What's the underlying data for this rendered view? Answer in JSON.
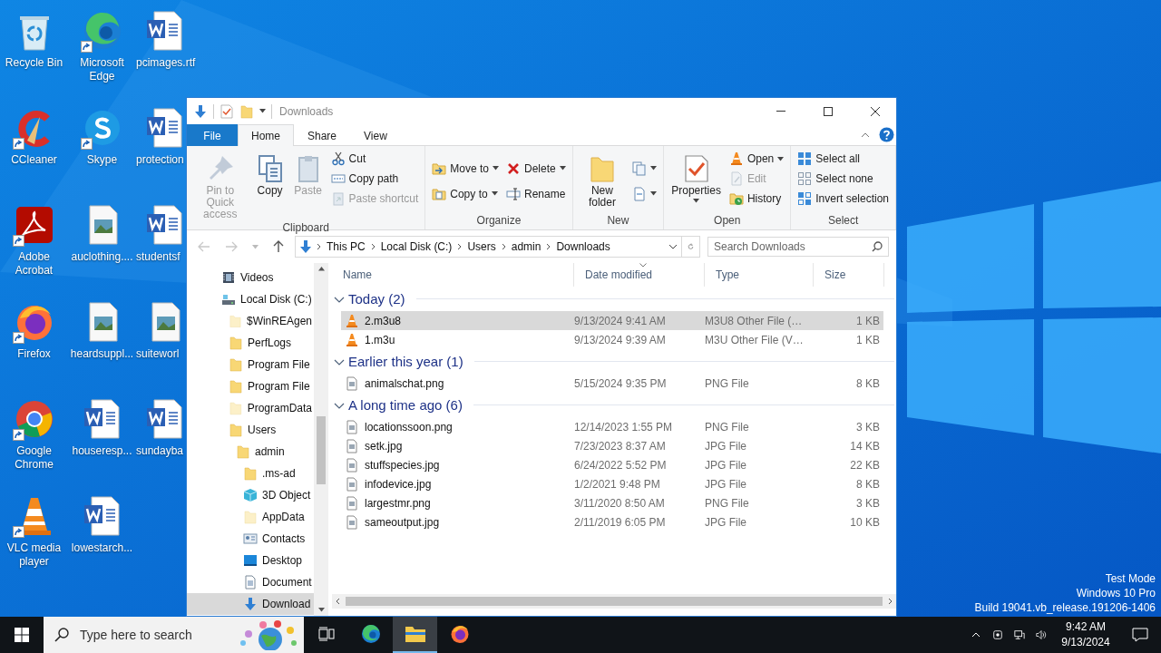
{
  "desktop": {
    "icons": [
      {
        "label": "Recycle Bin",
        "kind": "recycle",
        "shortcut": false
      },
      {
        "label": "CCleaner",
        "kind": "ccleaner",
        "shortcut": true
      },
      {
        "label": "Adobe Acrobat",
        "kind": "acrobat",
        "shortcut": true
      },
      {
        "label": "Firefox",
        "kind": "firefox",
        "shortcut": true
      },
      {
        "label": "Google Chrome",
        "kind": "chrome",
        "shortcut": true
      },
      {
        "label": "VLC media player",
        "kind": "vlc",
        "shortcut": true
      },
      {
        "label": "Microsoft Edge",
        "kind": "edge",
        "shortcut": true
      },
      {
        "label": "Skype",
        "kind": "skype",
        "shortcut": true
      },
      {
        "label": "auclothing....",
        "kind": "image",
        "shortcut": false
      },
      {
        "label": "heardsuppl...",
        "kind": "image",
        "shortcut": false
      },
      {
        "label": "houseresp...",
        "kind": "word",
        "shortcut": false
      },
      {
        "label": "lowestarch...",
        "kind": "word",
        "shortcut": false
      },
      {
        "label": "pcimages.rtf",
        "kind": "word",
        "shortcut": false
      },
      {
        "label": "protection",
        "kind": "word",
        "shortcut": false
      },
      {
        "label": "studentsf",
        "kind": "word",
        "shortcut": false
      },
      {
        "label": "suiteworl",
        "kind": "image",
        "shortcut": false
      },
      {
        "label": "sundayba",
        "kind": "word",
        "shortcut": false
      }
    ],
    "system_info": [
      "Test Mode",
      "Windows 10 Pro",
      "Build 19041.vb_release.191206-1406"
    ]
  },
  "window": {
    "title": "Downloads",
    "tabs": [
      {
        "label": "File",
        "kind": "menu",
        "selected": false
      },
      {
        "label": "Home",
        "kind": "tab",
        "selected": true
      },
      {
        "label": "Share",
        "kind": "tab",
        "selected": false
      },
      {
        "label": "View",
        "kind": "tab",
        "selected": false
      }
    ],
    "ribbon": [
      {
        "label": "Clipboard",
        "columns": [
          [
            {
              "label": "Pin to Quick access",
              "kind": "pin",
              "disabled": true,
              "menu": false
            }
          ],
          [
            {
              "label": "Copy",
              "kind": "copy",
              "disabled": false,
              "menu": false
            }
          ],
          [
            {
              "label": "Paste",
              "kind": "paste",
              "disabled": true,
              "menu": false
            }
          ],
          [
            {
              "label": "Cut",
              "kind": "cut",
              "disabled": false,
              "menu": false
            },
            {
              "label": "Copy path",
              "kind": "copypath",
              "disabled": false,
              "menu": false
            },
            {
              "label": "Paste shortcut",
              "kind": "pasteshortcut",
              "disabled": true,
              "menu": false
            }
          ]
        ]
      },
      {
        "label": "Organize",
        "columns": [
          [
            {
              "label": "Move to",
              "kind": "moveto",
              "disabled": false,
              "menu": true
            },
            {
              "label": "Copy to",
              "kind": "copyto",
              "disabled": false,
              "menu": true
            }
          ],
          [
            {
              "label": "Delete",
              "kind": "delete",
              "disabled": false,
              "menu": true
            },
            {
              "label": "Rename",
              "kind": "rename",
              "disabled": false,
              "menu": false
            }
          ]
        ]
      },
      {
        "label": "New",
        "columns": [
          [
            {
              "label": "New folder",
              "kind": "newfolder",
              "disabled": false,
              "menu": false
            }
          ],
          [
            {
              "kind": "newitem",
              "disabled": false,
              "menu": true
            },
            {
              "kind": "easyaccess",
              "disabled": false,
              "menu": true
            }
          ]
        ]
      },
      {
        "label": "Open",
        "columns": [
          [
            {
              "label": "Properties",
              "kind": "properties",
              "disabled": false,
              "menu": true
            }
          ],
          [
            {
              "label": "Open",
              "kind": "openvlc",
              "disabled": false,
              "menu": true
            },
            {
              "label": "Edit",
              "kind": "edit",
              "disabled": true,
              "menu": false
            },
            {
              "label": "History",
              "kind": "history",
              "disabled": false,
              "menu": false
            }
          ]
        ]
      },
      {
        "label": "Select",
        "columns": [
          [
            {
              "label": "Select all",
              "kind": "selectall",
              "disabled": false,
              "menu": false
            },
            {
              "label": "Select none",
              "kind": "selectnone",
              "disabled": false,
              "menu": false
            },
            {
              "label": "Invert selection",
              "kind": "invert",
              "disabled": false,
              "menu": false
            }
          ]
        ]
      }
    ],
    "address": {
      "crumbs": [
        "This PC",
        "Local Disk (C:)",
        "Users",
        "admin",
        "Downloads"
      ],
      "search": {
        "placeholder": "Search Downloads"
      }
    },
    "nav_pane": {
      "items": [
        {
          "label": "Videos",
          "kind": "videos",
          "selected": false
        },
        {
          "label": "Local Disk (C:)",
          "kind": "drive",
          "selected": false,
          "children": [
            {
              "label": "$WinREAgen",
              "kind": "hidden",
              "selected": false
            },
            {
              "label": "PerfLogs",
              "kind": "folder",
              "selected": false
            },
            {
              "label": "Program File",
              "kind": "folder",
              "selected": false
            },
            {
              "label": "Program File",
              "kind": "folder",
              "selected": false
            },
            {
              "label": "ProgramData",
              "kind": "hidden",
              "selected": false
            },
            {
              "label": "Users",
              "kind": "folder",
              "selected": false,
              "children": [
                {
                  "label": "admin",
                  "kind": "folder",
                  "selected": false,
                  "children": [
                    {
                      "label": ".ms-ad",
                      "kind": "folder",
                      "selected": false
                    },
                    {
                      "label": "3D Object",
                      "kind": "cube",
                      "selected": false
                    },
                    {
                      "label": "AppData",
                      "kind": "hidden",
                      "selected": false
                    },
                    {
                      "label": "Contacts",
                      "kind": "contacts",
                      "selected": false
                    },
                    {
                      "label": "Desktop",
                      "kind": "desktop",
                      "selected": false
                    },
                    {
                      "label": "Document",
                      "kind": "documents",
                      "selected": false
                    },
                    {
                      "label": "Download",
                      "kind": "downloads",
                      "selected": true
                    }
                  ]
                }
              ]
            }
          ]
        }
      ]
    },
    "file_list": {
      "columns": [
        "Name",
        "Date modified",
        "Type",
        "Size"
      ],
      "groups": [
        {
          "title": "Today (2)",
          "expanded": true,
          "files": [
            {
              "name": "2.m3u8",
              "date": "9/13/2024 9:41 AM",
              "type": "M3U8 Other File (…",
              "size": "1 KB",
              "kind": "vlc",
              "selected": true
            },
            {
              "name": "1.m3u",
              "date": "9/13/2024 9:39 AM",
              "type": "M3U Other File (V…",
              "size": "1 KB",
              "kind": "vlc",
              "selected": false
            }
          ]
        },
        {
          "title": "Earlier this year (1)",
          "expanded": true,
          "files": [
            {
              "name": "animalschat.png",
              "date": "5/15/2024 9:35 PM",
              "type": "PNG File",
              "size": "8 KB",
              "kind": "image",
              "selected": false
            }
          ]
        },
        {
          "title": "A long time ago (6)",
          "expanded": true,
          "files": [
            {
              "name": "locationssoon.png",
              "date": "12/14/2023 1:55 PM",
              "type": "PNG File",
              "size": "3 KB",
              "kind": "image",
              "selected": false
            },
            {
              "name": "setk.jpg",
              "date": "7/23/2023 8:37 AM",
              "type": "JPG File",
              "size": "14 KB",
              "kind": "image",
              "selected": false
            },
            {
              "name": "stuffspecies.jpg",
              "date": "6/24/2022 5:52 PM",
              "type": "JPG File",
              "size": "22 KB",
              "kind": "image",
              "selected": false
            },
            {
              "name": "infodevice.jpg",
              "date": "1/2/2021 9:48 PM",
              "type": "JPG File",
              "size": "8 KB",
              "kind": "image",
              "selected": false
            },
            {
              "name": "largestmr.png",
              "date": "3/11/2020 8:50 AM",
              "type": "PNG File",
              "size": "3 KB",
              "kind": "image",
              "selected": false
            },
            {
              "name": "sameoutput.jpg",
              "date": "2/11/2019 6:05 PM",
              "type": "JPG File",
              "size": "10 KB",
              "kind": "image",
              "selected": false
            }
          ]
        }
      ]
    }
  },
  "taskbar": {
    "search": {
      "placeholder": "Type here to search"
    },
    "apps": [
      {
        "kind": "taskview",
        "active": false
      },
      {
        "kind": "edge",
        "active": false
      },
      {
        "kind": "explorer",
        "active": true
      },
      {
        "kind": "firefox",
        "active": false
      }
    ],
    "time": "9:42 AM",
    "date": "9/13/2024"
  }
}
